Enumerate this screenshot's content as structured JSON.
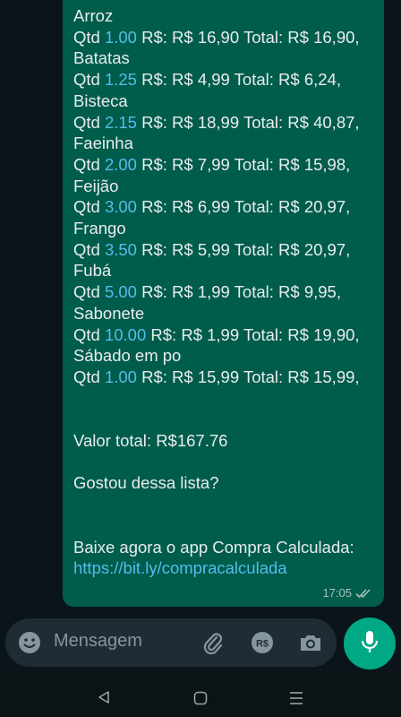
{
  "message": {
    "items": [
      {
        "name": "Arroz",
        "qty": "1.00",
        "price": "R$: R$ 16,90",
        "total": "Total: R$ 16,90,"
      },
      {
        "name": "Batatas",
        "qty": "1.25",
        "price": "R$: R$ 4,99",
        "total": "Total: R$ 6,24,"
      },
      {
        "name": "Bisteca",
        "qty": "2.15",
        "price": "R$: R$ 18,99",
        "total": "Total: R$ 40,87,"
      },
      {
        "name": "Faeinha",
        "qty": "2.00",
        "price": "R$: R$ 7,99",
        "total": "Total: R$ 15,98,"
      },
      {
        "name": "Feijão",
        "qty": "3.00",
        "price": "R$: R$ 6,99",
        "total": "Total: R$ 20,97,"
      },
      {
        "name": "Frango",
        "qty": "3.50",
        "price": "R$: R$ 5,99",
        "total": "Total: R$ 20,97,"
      },
      {
        "name": "Fubá",
        "qty": "5.00",
        "price": "R$: R$ 1,99",
        "total": "Total: R$ 9,95,"
      },
      {
        "name": "Sabonete",
        "qty": "10.00",
        "price": "R$: R$ 1,99",
        "total": "Total: R$ 19,90,"
      },
      {
        "name": "Sábado em po",
        "qty": "1.00",
        "price": "R$: R$ 15,99",
        "total": "Total: R$ 15,99,"
      }
    ],
    "qty_label": "Qtd",
    "valor_total": "Valor total: R$167.76",
    "question": "Gostou dessa lista?",
    "promo": "Baixe agora o app Compra Calculada:",
    "link": "https://bit.ly/compracalculada",
    "time": "17:05"
  },
  "input": {
    "placeholder": "Mensagem",
    "rs_icon_label": "R$"
  },
  "colors": {
    "bubble": "#005c4b",
    "accent": "#53bdeb",
    "mic": "#00a884",
    "background": "#0b141a"
  },
  "icons": [
    "emoji-icon",
    "paperclip-icon",
    "rs-icon",
    "camera-icon",
    "mic-icon",
    "double-check-icon",
    "nav-back-icon",
    "nav-home-icon",
    "nav-recents-icon"
  ]
}
